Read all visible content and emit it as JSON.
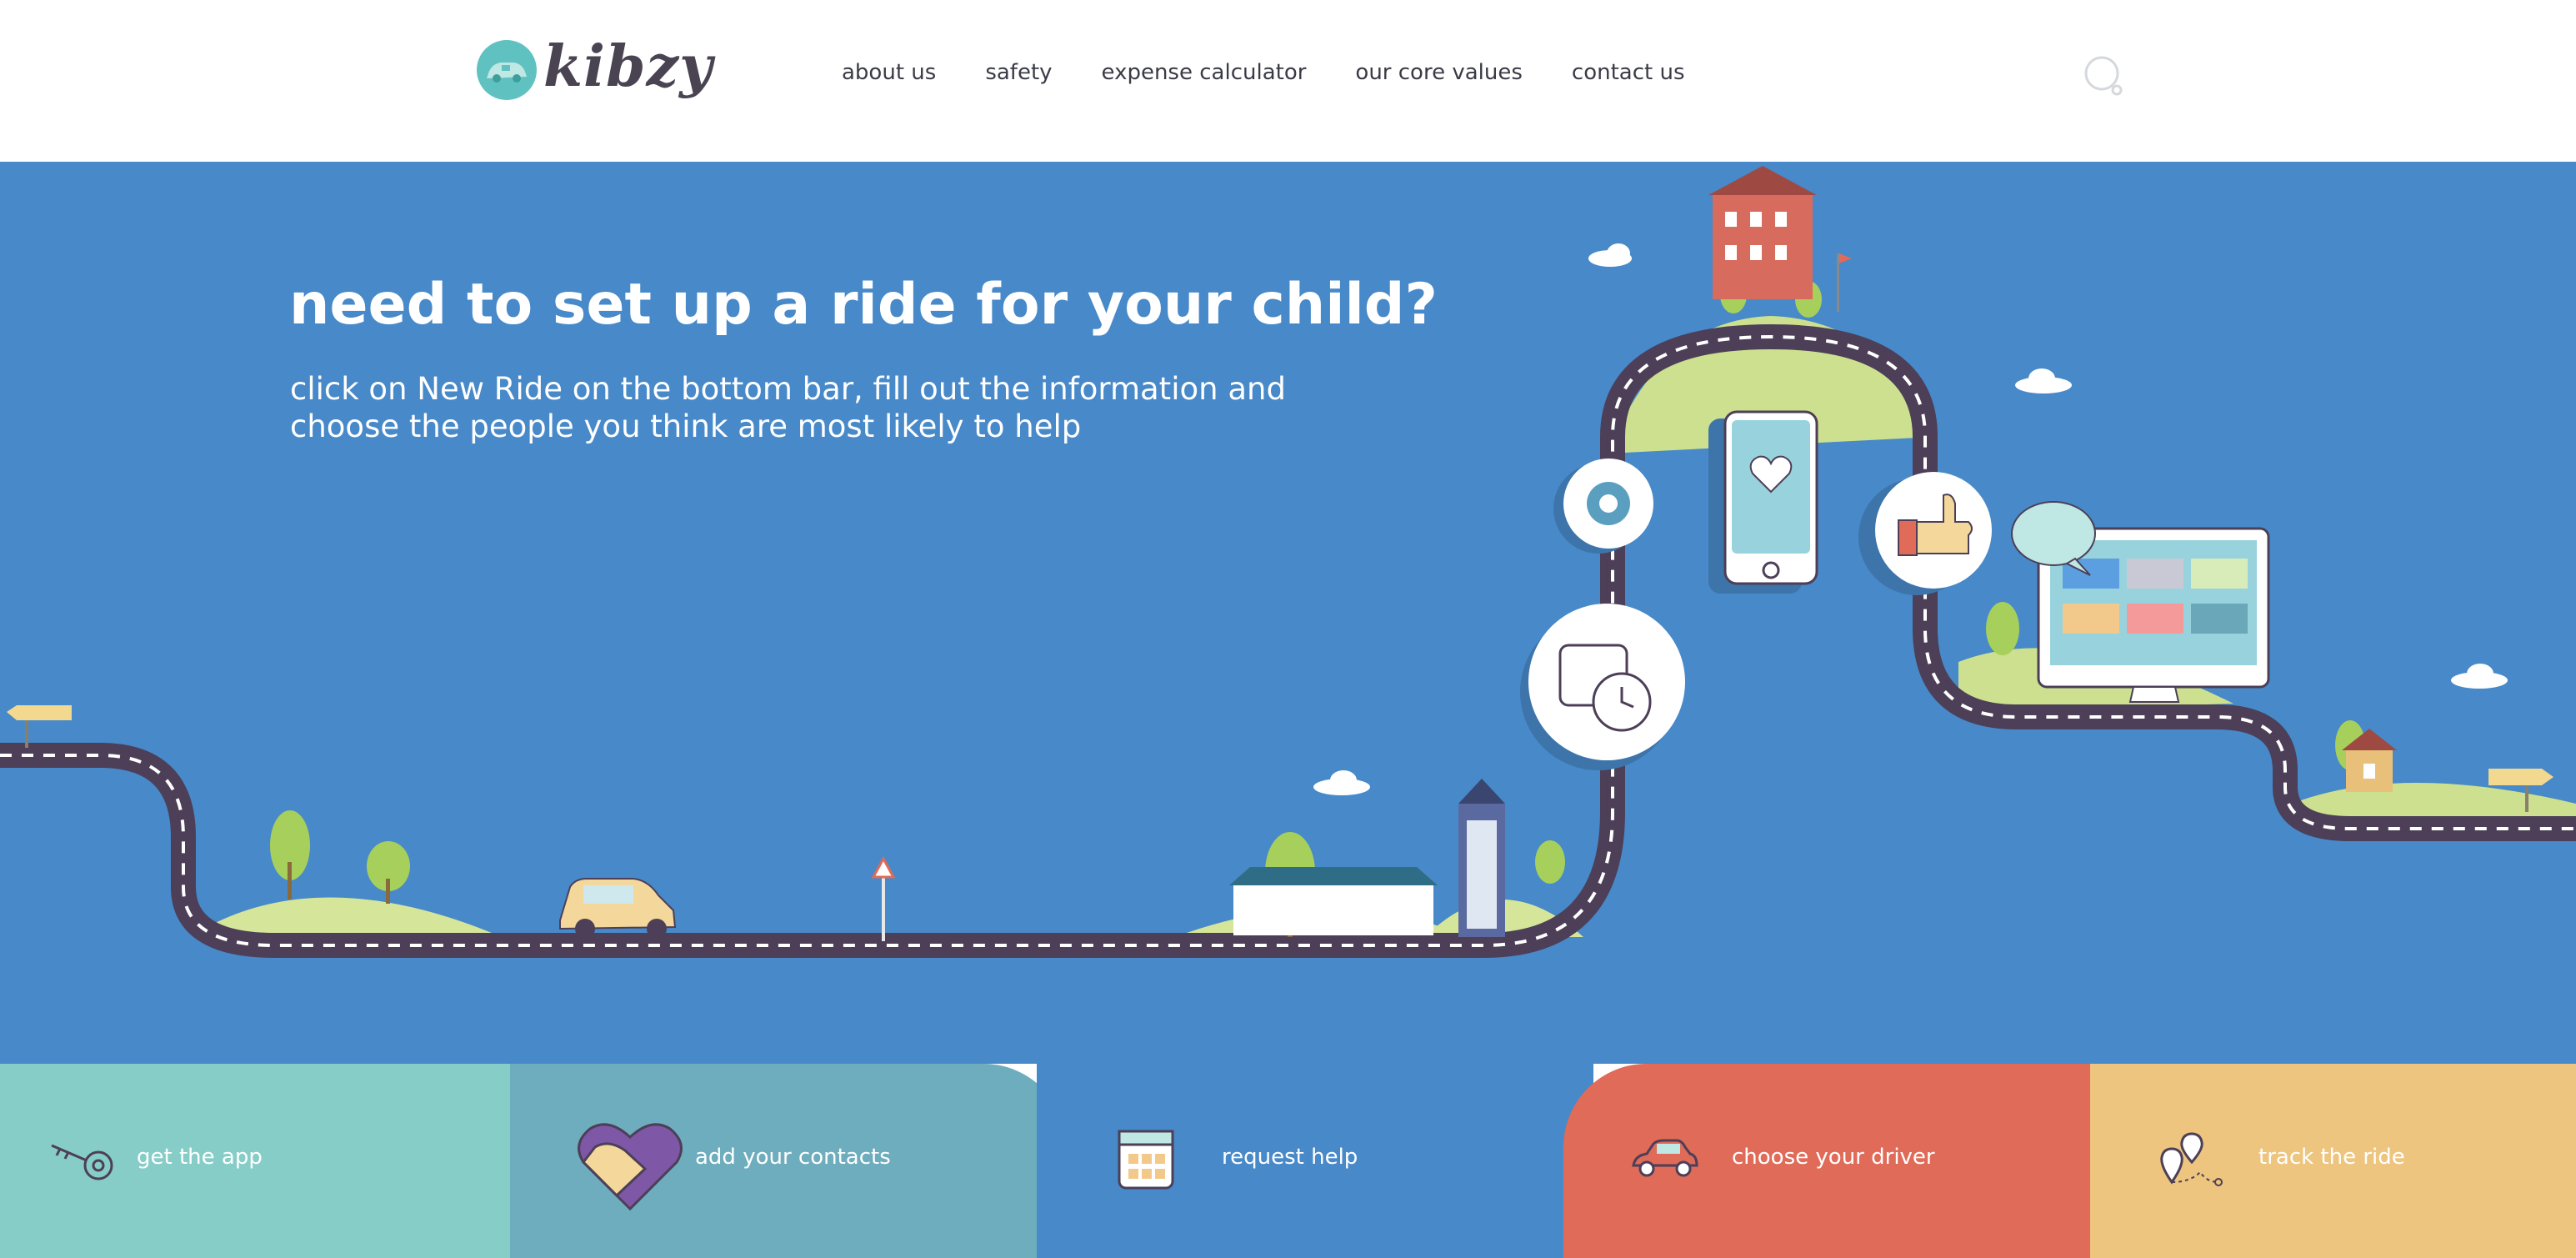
{
  "header": {
    "logo_text": "kibzy",
    "nav": [
      {
        "label": "about us"
      },
      {
        "label": "safety"
      },
      {
        "label": "expense calculator"
      },
      {
        "label": "our core values"
      },
      {
        "label": "contact us"
      }
    ],
    "search_icon": "search-icon"
  },
  "hero": {
    "title": "need to set up a ride for your child?",
    "subtitle": "click on New Ride on the bottom bar, fill out the information and choose the people you think are most likely to help"
  },
  "steps": [
    {
      "label": "get the app",
      "icon": "key-icon",
      "color": "#86cdc8"
    },
    {
      "label": "add your contacts",
      "icon": "handshake-icon",
      "color": "#6eadbd"
    },
    {
      "label": "request help",
      "icon": "calendar-icon",
      "color": "#4789c9"
    },
    {
      "label": "choose your driver",
      "icon": "car-icon",
      "color": "#e06b58"
    },
    {
      "label": "track the ride",
      "icon": "map-pin-icon",
      "color": "#eec57e"
    }
  ],
  "colors": {
    "hero_bg": "#4789c9",
    "road": "#4c3f57",
    "grass": "#cde08f",
    "text_dark": "#3b3b47"
  }
}
